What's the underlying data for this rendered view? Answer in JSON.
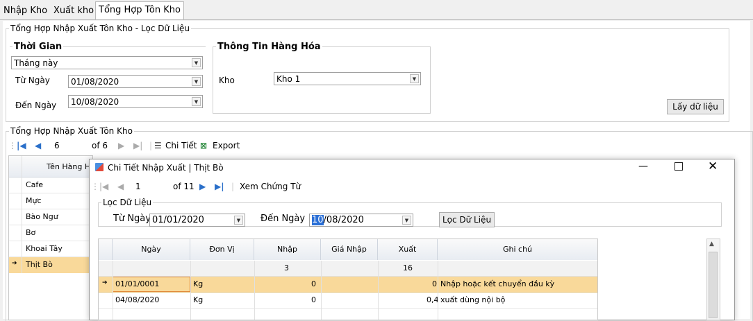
{
  "tabs": [
    "Nhập Kho",
    "Xuất kho",
    "Tổng Hợp Tôn Kho"
  ],
  "filter_group": {
    "title": "Tổng Hợp Nhập Xuất Tôn Kho - Lọc Dữ Liệu",
    "time": {
      "title": "Thời Gian",
      "period_value": "Tháng này",
      "from_label": "Từ Ngày",
      "from_value": "01/08/2020",
      "to_label": "Đến Ngày",
      "to_value": "10/08/2020"
    },
    "goods": {
      "title": "Thông Tin Hàng Hóa",
      "kho_label": "Kho",
      "kho_value": "Kho 1"
    },
    "get_data_button": "Lấy dữ liệu"
  },
  "summary": {
    "title": "Tổng Hợp Nhập Xuất Tôn Kho",
    "nav": {
      "position": "6",
      "of": "of 6",
      "detail": "Chi Tiết",
      "export": "Export"
    },
    "column": "Tên Hàng H",
    "rows": [
      "Cafe",
      "Mực",
      "Bào Ngư",
      "Bơ",
      "Khoai Tây",
      "Thịt Bò"
    ],
    "selected_index": 5
  },
  "dialog": {
    "title": "Chi Tiết Nhập Xuất | Thịt Bò",
    "nav": {
      "position": "1",
      "of": "of 11",
      "view": "Xem Chứng Từ"
    },
    "filter": {
      "title": "Lọc Dữ Liệu",
      "from_label": "Từ Ngày",
      "from_value": "01/01/2020",
      "to_label": "Đến Ngày",
      "to_value_sel": "10",
      "to_value_rest": "/08/2020",
      "button": "Lọc Dữ Liệu"
    },
    "columns": [
      "Ngày",
      "Đơn Vị",
      "Nhập",
      "Giá Nhập",
      "Xuất",
      "Ghi chú"
    ],
    "totals": {
      "nhap": "3",
      "xuat": "16"
    },
    "rows": [
      {
        "ngay": "01/01/0001",
        "donvi": "Kg",
        "nhap": "0",
        "gianhap": "",
        "xuat": "0",
        "ghichu": "Nhập hoặc kết chuyển đầu kỳ"
      },
      {
        "ngay": "04/08/2020",
        "donvi": "Kg",
        "nhap": "0",
        "gianhap": "",
        "xuat": "0,4",
        "ghichu": "xuất dùng nội bộ"
      }
    ]
  },
  "colors": {
    "selected_row": "#f9d99a",
    "focus_border": "#e08a3a",
    "header_bg": "#eef1f6"
  }
}
